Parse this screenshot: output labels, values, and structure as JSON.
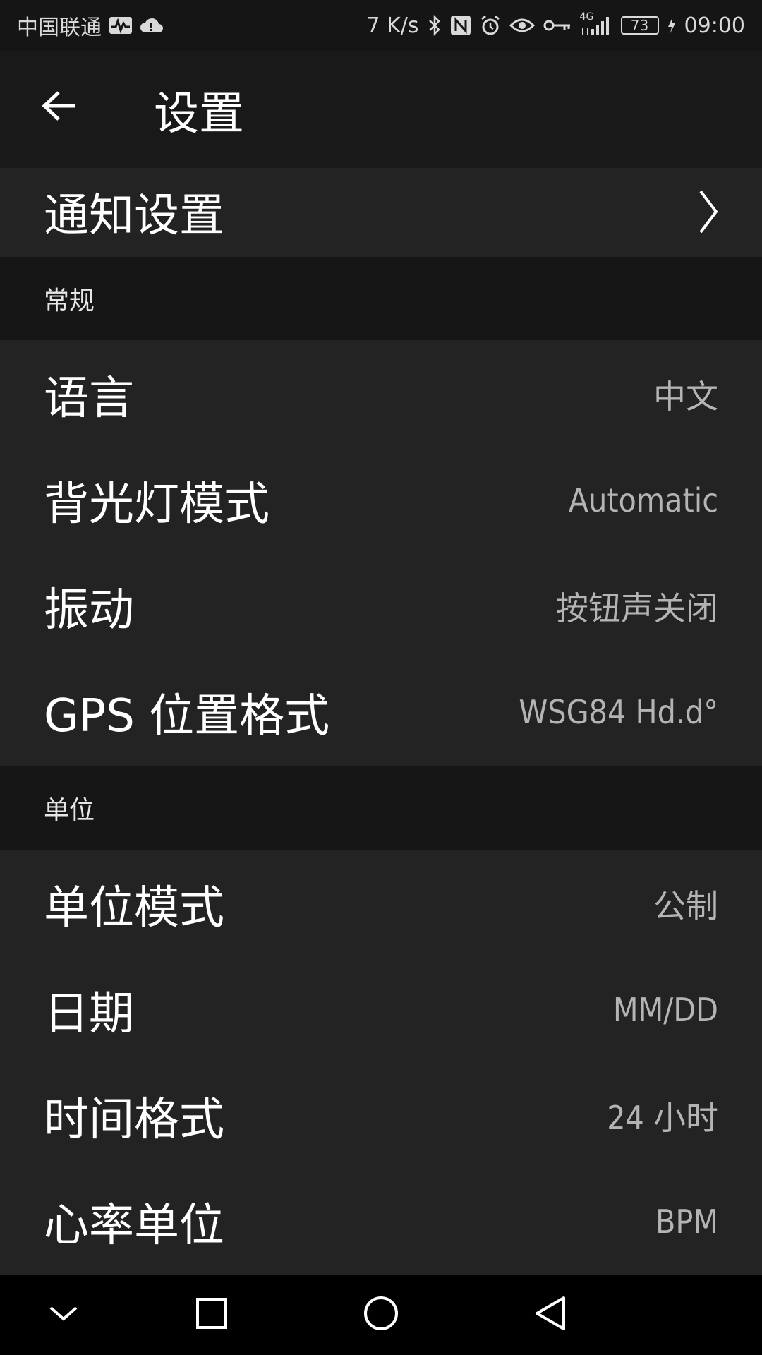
{
  "status_bar": {
    "carrier": "中国联通",
    "net_speed": "7 K/s",
    "network_type": "4G",
    "battery": "73",
    "time": "09:00",
    "icons": [
      "activity-icon",
      "cloud-icon",
      "bluetooth-icon",
      "nfc-icon",
      "alarm-icon",
      "eye-icon",
      "key-icon",
      "signal-icon",
      "charging-icon"
    ]
  },
  "header": {
    "title": "设置",
    "back_icon": "arrow-left-icon"
  },
  "notification_row": {
    "label": "通知设置",
    "chevron_icon": "chevron-right-icon"
  },
  "sections": {
    "general": {
      "title": "常规",
      "items": [
        {
          "label": "语言",
          "value": "中文"
        },
        {
          "label": "背光灯模式",
          "value": "Automatic"
        },
        {
          "label": "振动",
          "value": "按钮声关闭"
        },
        {
          "label": "GPS 位置格式",
          "value": "WSG84 Hd.d°"
        }
      ]
    },
    "units": {
      "title": "单位",
      "items": [
        {
          "label": "单位模式",
          "value": "公制"
        },
        {
          "label": "日期",
          "value": "MM/DD"
        },
        {
          "label": "时间格式",
          "value": "24 小时"
        },
        {
          "label": "心率单位",
          "value": "BPM"
        }
      ]
    }
  },
  "nav_bar": {
    "icons": [
      "chevron-down-icon",
      "recents-square-icon",
      "home-circle-icon",
      "back-triangle-icon"
    ]
  },
  "colors": {
    "background": "#232323",
    "section_bg": "#161616",
    "header_bg": "#191919",
    "value_text": "#b4b4b4"
  }
}
